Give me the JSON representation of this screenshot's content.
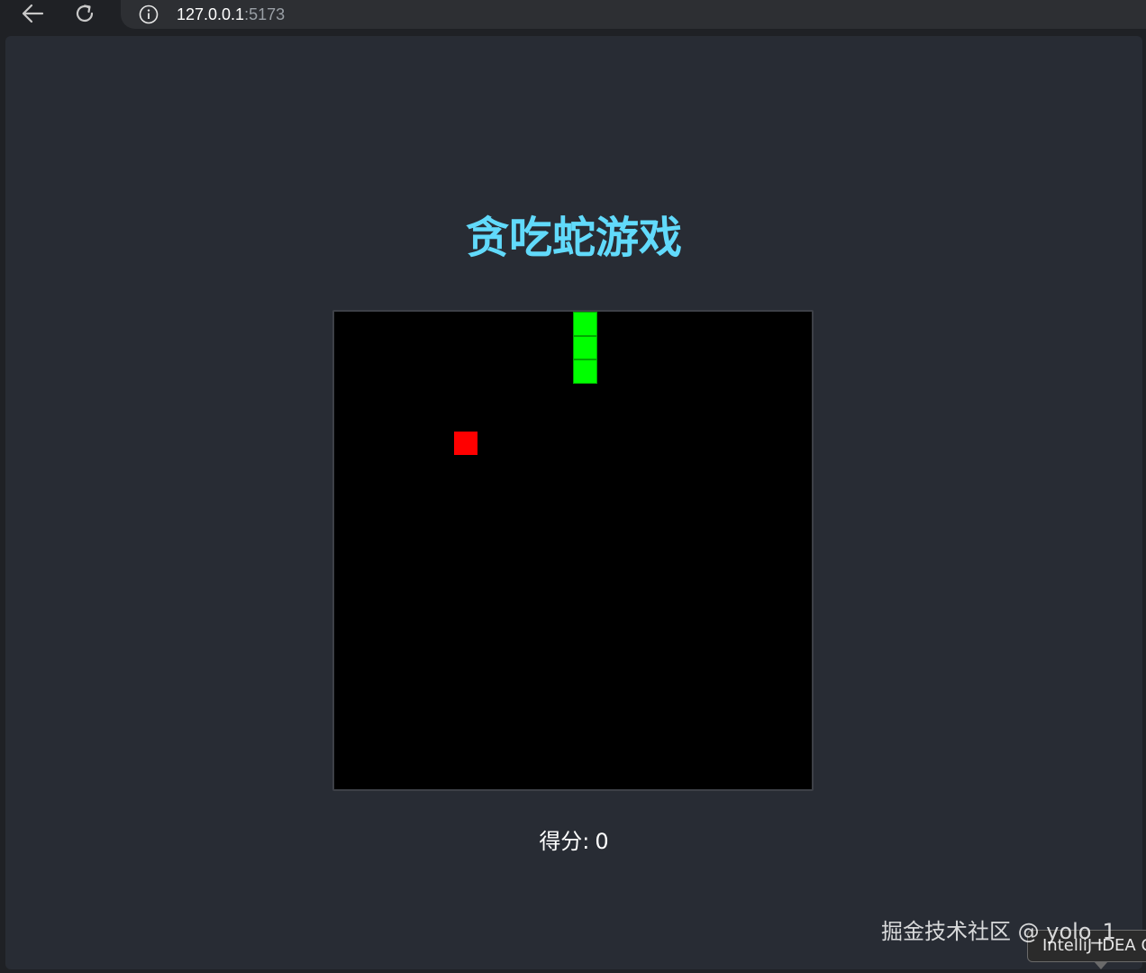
{
  "browser": {
    "url_host": "127.0.0.1",
    "url_port": ":5173",
    "icons": {
      "back": "arrow-left-icon",
      "reload": "reload-icon",
      "site_info": "info-icon"
    }
  },
  "game": {
    "title": "贪吃蛇游戏",
    "score_label": "得分:",
    "score": 0,
    "grid": {
      "columns": 20,
      "rows": 20
    },
    "snake": [
      {
        "col": 10,
        "row": 0
      },
      {
        "col": 10,
        "row": 1
      },
      {
        "col": 10,
        "row": 2
      }
    ],
    "food": {
      "col": 5,
      "row": 5
    },
    "colors": {
      "title": "#61dafb",
      "page_background": "#282c34",
      "board": "#000000",
      "snake": "#00ff00",
      "food": "#ff0000",
      "score_text": "#ffffff"
    }
  },
  "overlay": {
    "watermark": "掘金技术社区 @ yolo_1",
    "tooltip": "IntelliJ IDEA C"
  }
}
